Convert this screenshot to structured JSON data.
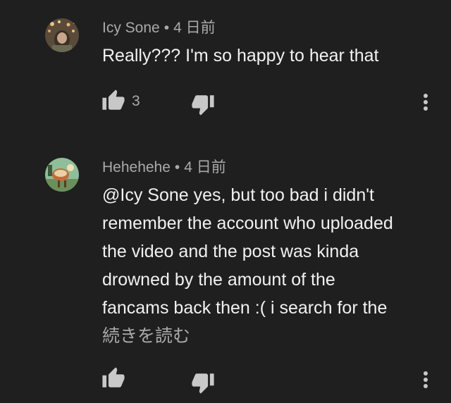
{
  "comments": [
    {
      "author": "Icy Sone",
      "separator": "•",
      "time": "4 日前",
      "text": "Really??? I'm so happy to hear that",
      "like_count": "3",
      "icons": {
        "like": "thumbs-up-icon",
        "dislike": "thumbs-down-icon",
        "more": "more-vert-icon"
      }
    },
    {
      "author": "Hehehehe",
      "separator": "•",
      "time": "4 日前",
      "text_lines": [
        "@Icy Sone yes, but too bad i didn't",
        "remember the account who uploaded",
        "the video and the post was kinda",
        "drowned by the amount of the",
        "fancams back then :( i search for the"
      ],
      "read_more": "続きを読む",
      "icons": {
        "like": "thumbs-up-icon",
        "dislike": "thumbs-down-icon",
        "more": "more-vert-icon"
      }
    }
  ],
  "colors": {
    "background": "#1f1f1f",
    "text_primary": "#f1f1f1",
    "text_secondary": "#aaaaaa",
    "icon": "#c8c8c8"
  }
}
